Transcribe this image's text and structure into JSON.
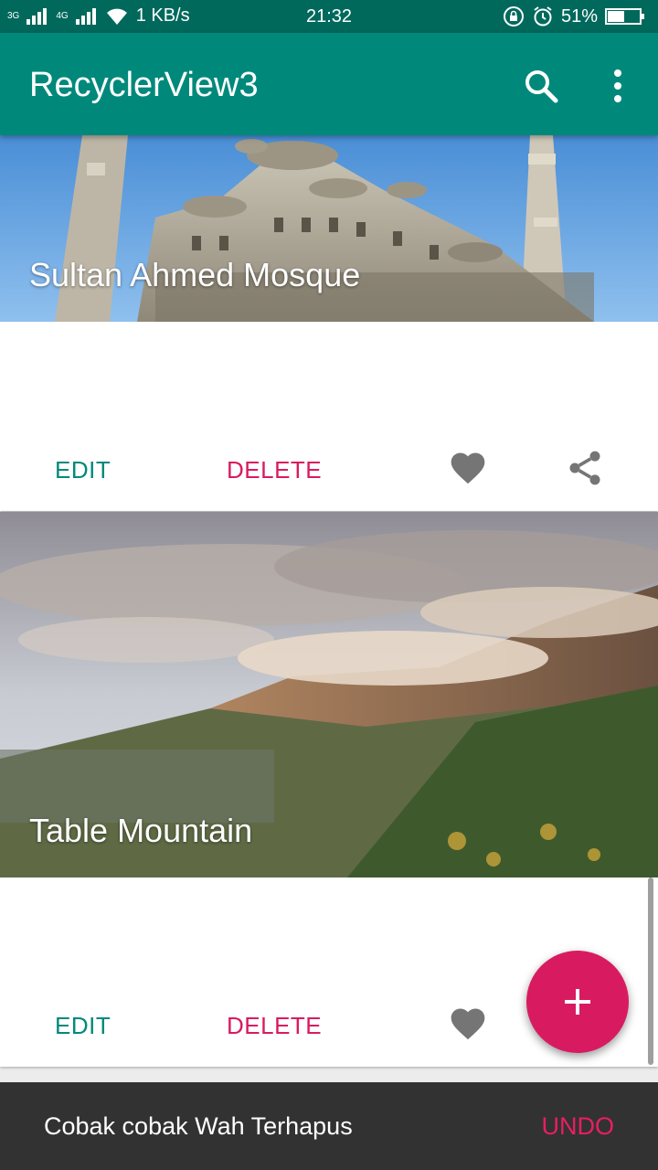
{
  "status_bar": {
    "network_3g": "3G",
    "network_4g": "4G",
    "speed": "1 KB/s",
    "time": "21:32",
    "battery": "51%",
    "icons": [
      "signal-icon",
      "wifi-icon",
      "lock-rotation-icon",
      "alarm-icon",
      "battery-icon"
    ]
  },
  "app_bar": {
    "title": "RecyclerView3",
    "actions": [
      "search-icon",
      "more-vert-icon"
    ]
  },
  "cards": [
    {
      "title": "Sultan Ahmed Mosque",
      "edit_label": "EDIT",
      "delete_label": "DELETE",
      "icons": [
        "favorite-icon",
        "share-icon"
      ]
    },
    {
      "title": "Table Mountain",
      "edit_label": "EDIT",
      "delete_label": "DELETE",
      "icons": [
        "favorite-icon"
      ]
    }
  ],
  "fab": {
    "icon": "plus-icon"
  },
  "snackbar": {
    "message": "Cobak cobak Wah Terhapus",
    "action": "UNDO"
  },
  "colors": {
    "primary": "#00897b",
    "primary_dark": "#00695c",
    "accent": "#d81b60",
    "snackbar_bg": "#323232"
  }
}
